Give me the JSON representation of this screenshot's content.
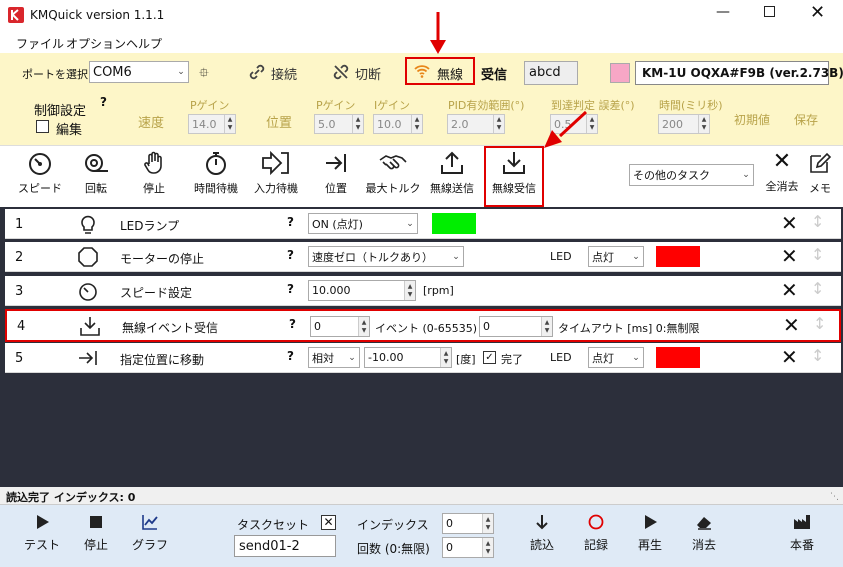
{
  "window": {
    "title": "KMQuick version 1.1.1"
  },
  "menu": [
    "ファイル",
    "オプション",
    "ヘルプ"
  ],
  "connection": {
    "port_label": "ポートを選択",
    "port_value": "COM6",
    "connect_label": "接続",
    "disconnect_label": "切断",
    "wireless_label": "無線",
    "receive_label": "受信",
    "receive_value": "abcd",
    "device_name": "KM-1U OQXA#F9B (ver.2.73B)",
    "device_color": "#f7a7c6"
  },
  "control": {
    "title": "制御設定",
    "help": "?",
    "edit_label": "編集",
    "speed_label": "速度",
    "position_label": "位置",
    "speed_gain_label": "Pゲイン",
    "speed_gain_value": "14.0",
    "pos_pgain_label": "Pゲイン",
    "pos_pgain_value": "5.0",
    "pos_igain_label": "Iゲイン",
    "pos_igain_value": "10.0",
    "pid_range_label": "PID有効範囲(°)",
    "pid_range_value": "2.0",
    "arrival_label": "到達判定 誤差(°)",
    "arrival_value": "0.5",
    "time_label": "時間(ミリ秒)",
    "time_value": "200",
    "initial_label": "初期値",
    "save_label": "保存"
  },
  "toolbar": {
    "buttons": [
      "スピード",
      "回転",
      "停止",
      "時間待機",
      "入力待機",
      "位置",
      "最大トルク",
      "無線送信",
      "無線受信"
    ],
    "other_tasks": "その他のタスク",
    "clear_all": "全消去",
    "memo": "メモ"
  },
  "tasks": [
    {
      "num": "1",
      "label": "LEDランプ",
      "q": "?",
      "select": "ON (点灯)",
      "color": "#00ee00"
    },
    {
      "num": "2",
      "label": "モーターの停止",
      "q": "?",
      "select": "速度ゼロ（トルクあり）",
      "led_label": "LED",
      "led_value": "点灯",
      "color": "#ff0000"
    },
    {
      "num": "3",
      "label": "スピード設定",
      "q": "?",
      "value": "10.000",
      "unit": "[rpm]"
    },
    {
      "num": "4",
      "label": "無線イベント受信",
      "q": "?",
      "event_value": "0",
      "event_label": "イベント (0-65535)",
      "timeout_value": "0",
      "timeout_label": "タイムアウト [ms] 0:無制限"
    },
    {
      "num": "5",
      "label": "指定位置に移動",
      "q": "?",
      "mode": "相対",
      "value": "-10.00",
      "unit": "[度]",
      "done_label": "完了",
      "led_label": "LED",
      "led_value": "点灯",
      "color": "#ff0000"
    }
  ],
  "status": {
    "text": "読込完了 インデックス: 0"
  },
  "bottom": {
    "test": "テスト",
    "stop": "停止",
    "graph": "グラフ",
    "taskset_label": "タスクセット",
    "taskset_value": "send01-2",
    "index_label": "インデックス",
    "index_value": "0",
    "count_label": "回数 (0:無限)",
    "count_value": "0",
    "load": "読込",
    "record": "記録",
    "play": "再生",
    "erase": "消去",
    "production": "本番"
  },
  "annotation_color": "#e00000"
}
